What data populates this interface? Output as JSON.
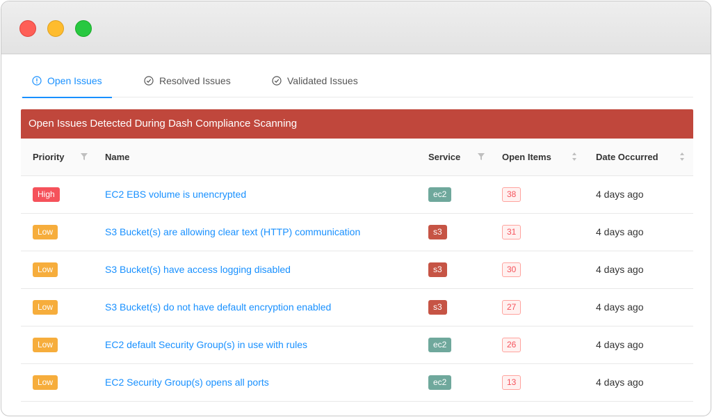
{
  "tabs": [
    {
      "label": "Open Issues",
      "icon": "info-circle-icon",
      "active": true
    },
    {
      "label": "Resolved Issues",
      "icon": "check-circle-icon",
      "active": false
    },
    {
      "label": "Validated Issues",
      "icon": "check-circle-icon",
      "active": false
    }
  ],
  "banner": {
    "title": "Open Issues Detected During Dash Compliance Scanning"
  },
  "table": {
    "columns": {
      "priority": "Priority",
      "name": "Name",
      "service": "Service",
      "open_items": "Open Items",
      "date": "Date Occurred"
    },
    "rows": [
      {
        "priority": "High",
        "name": "EC2 EBS volume is unencrypted",
        "service": "ec2",
        "open_items": "38",
        "date": "4 days ago"
      },
      {
        "priority": "Low",
        "name": "S3 Bucket(s) are allowing clear text (HTTP) communication",
        "service": "s3",
        "open_items": "31",
        "date": "4 days ago"
      },
      {
        "priority": "Low",
        "name": "S3 Bucket(s) have access logging disabled",
        "service": "s3",
        "open_items": "30",
        "date": "4 days ago"
      },
      {
        "priority": "Low",
        "name": "S3 Bucket(s) do not have default encryption enabled",
        "service": "s3",
        "open_items": "27",
        "date": "4 days ago"
      },
      {
        "priority": "Low",
        "name": "EC2 default Security Group(s) in use with rules",
        "service": "ec2",
        "open_items": "26",
        "date": "4 days ago"
      },
      {
        "priority": "Low",
        "name": "EC2 Security Group(s) opens all ports",
        "service": "ec2",
        "open_items": "13",
        "date": "4 days ago"
      }
    ]
  },
  "colors": {
    "accent": "#1890ff",
    "banner": "#c0473c",
    "high": "#f5525b",
    "low": "#f6ad3c",
    "ec2": "#6fa89c",
    "s3": "#c65445"
  }
}
